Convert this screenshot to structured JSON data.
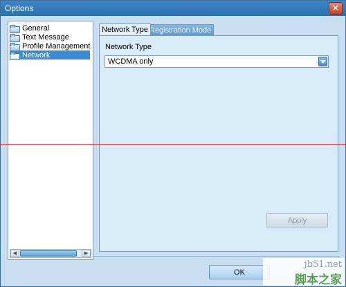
{
  "window": {
    "title": "Options",
    "close_glyph": "✕"
  },
  "tree": {
    "items": [
      {
        "label": "General",
        "icon": "folder-icon",
        "selected": false
      },
      {
        "label": "Text Message",
        "icon": "folder-icon",
        "selected": false
      },
      {
        "label": "Profile Management",
        "icon": "folder-icon",
        "selected": false
      },
      {
        "label": "Network",
        "icon": "folder-open-icon",
        "selected": true
      }
    ],
    "scroll_left_glyph": "◀",
    "scroll_right_glyph": "▶"
  },
  "tabs": [
    {
      "label": "Network Type",
      "active": true
    },
    {
      "label": "Registration Mode",
      "active": false
    }
  ],
  "network_type": {
    "label": "Network Type",
    "selected": "WCDMA only"
  },
  "buttons": {
    "apply": "Apply",
    "ok": "OK"
  },
  "watermark": {
    "line1": "jb51.net",
    "line2": "脚本之家"
  },
  "colors": {
    "titlebar": "#2b6fae",
    "selection": "#3c8ad6",
    "overlay_line": "#e0262d"
  }
}
